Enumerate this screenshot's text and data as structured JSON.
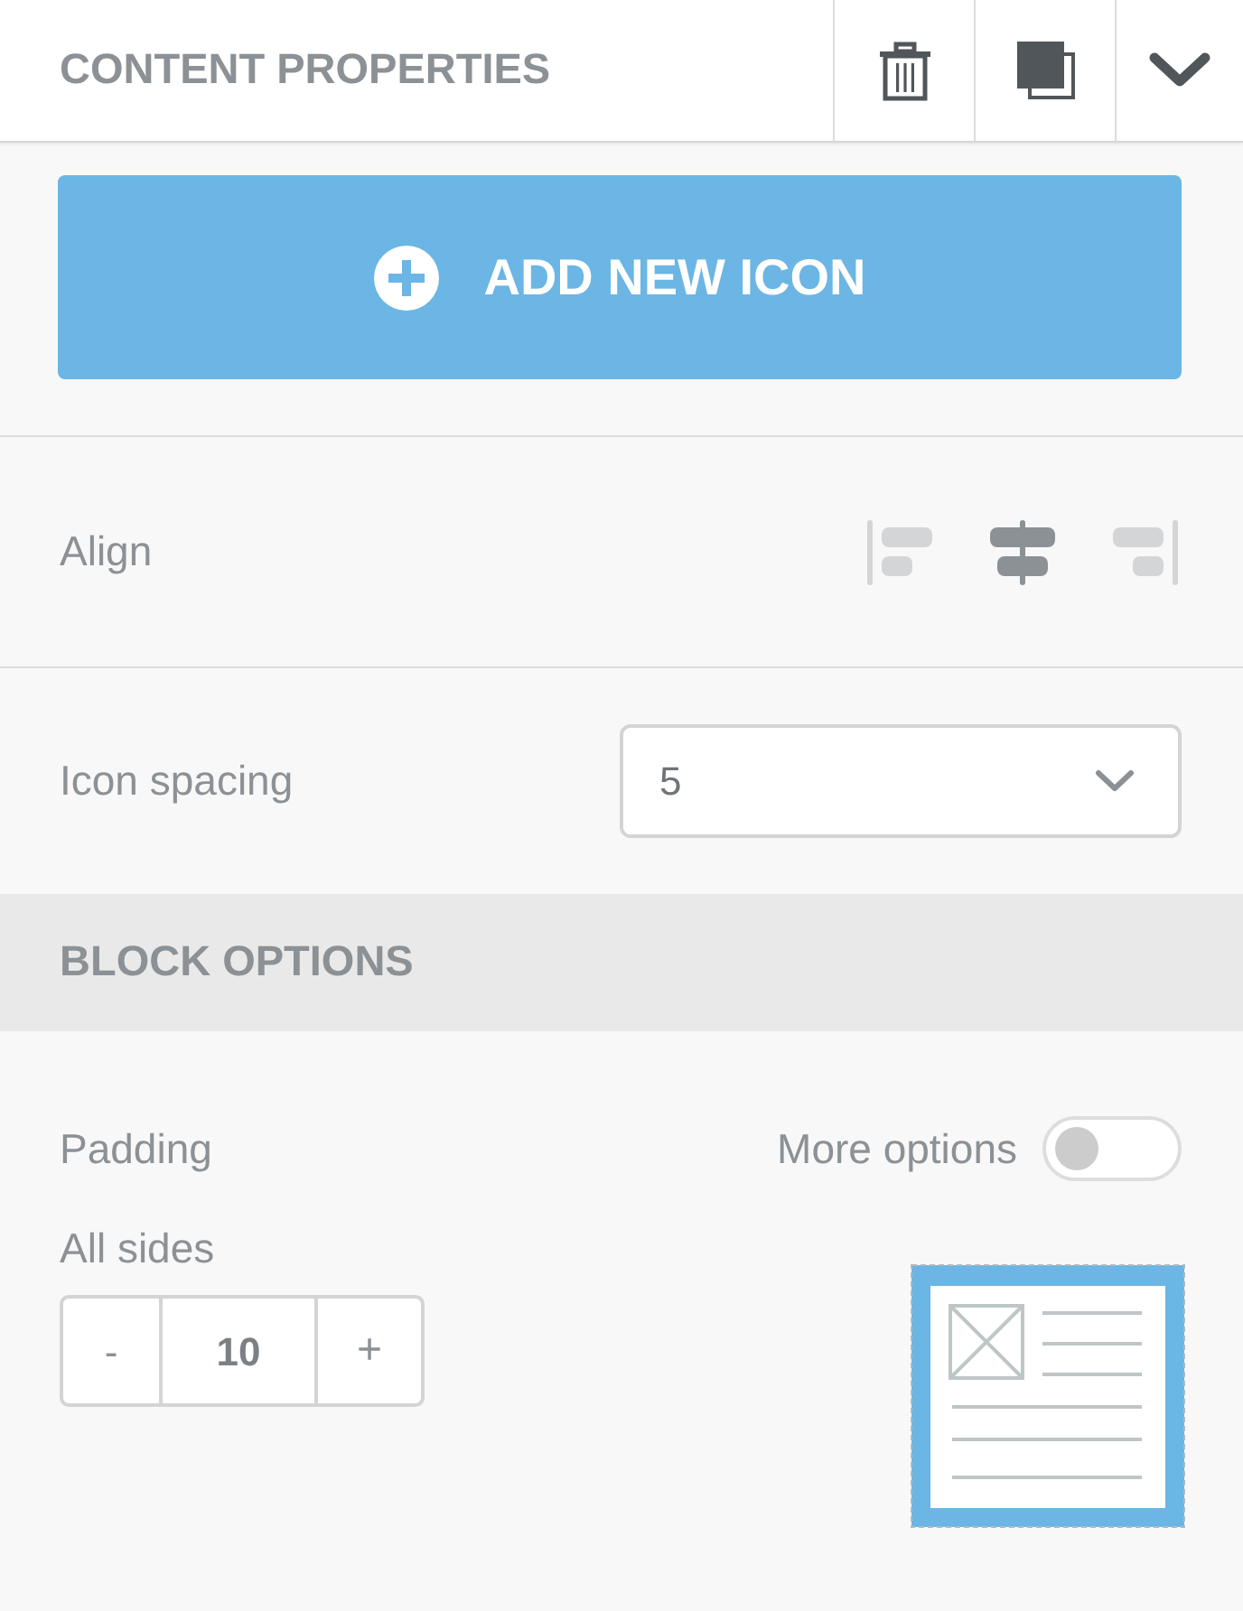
{
  "header": {
    "title": "CONTENT PROPERTIES"
  },
  "add_button": {
    "label": "ADD NEW ICON"
  },
  "align": {
    "label": "Align",
    "options": [
      {
        "kind": "left",
        "selected": false
      },
      {
        "kind": "center",
        "selected": true
      },
      {
        "kind": "right",
        "selected": false
      }
    ]
  },
  "icon_spacing": {
    "label": "Icon spacing",
    "value": "5"
  },
  "block_options": {
    "title": "BLOCK OPTIONS",
    "padding": {
      "label": "Padding",
      "more_options": {
        "label": "More options",
        "on": false
      },
      "all_sides": {
        "label": "All sides",
        "decrement": "-",
        "value": "10",
        "increment": "+"
      }
    }
  }
}
